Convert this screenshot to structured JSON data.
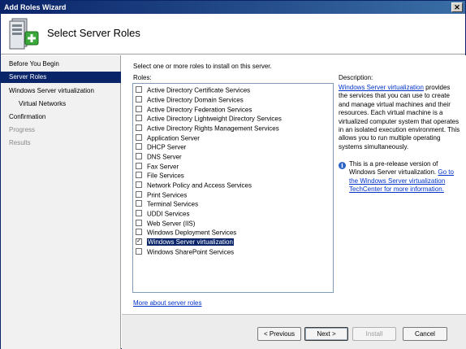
{
  "window": {
    "title": "Add Roles Wizard",
    "close_glyph": "✕"
  },
  "header": {
    "title": "Select Server Roles",
    "icon": "server-add-icon"
  },
  "nav": {
    "items": [
      {
        "label": "Before You Begin",
        "state": "normal"
      },
      {
        "label": "Server Roles",
        "state": "active"
      },
      {
        "label": "Windows Server virtualization",
        "state": "normal"
      },
      {
        "label": "Virtual Networks",
        "state": "sub"
      },
      {
        "label": "Confirmation",
        "state": "normal"
      },
      {
        "label": "Progress",
        "state": "disabled"
      },
      {
        "label": "Results",
        "state": "disabled"
      }
    ]
  },
  "main": {
    "instruction": "Select one or more roles to install on this server.",
    "roles_label": "Roles:",
    "roles": [
      {
        "label": "Active Directory Certificate Services",
        "checked": false
      },
      {
        "label": "Active Directory Domain Services",
        "checked": false
      },
      {
        "label": "Active Directory Federation Services",
        "checked": false
      },
      {
        "label": "Active Directory Lightweight Directory Services",
        "checked": false
      },
      {
        "label": "Active Directory Rights Management Services",
        "checked": false
      },
      {
        "label": "Application Server",
        "checked": false
      },
      {
        "label": "DHCP Server",
        "checked": false
      },
      {
        "label": "DNS Server",
        "checked": false
      },
      {
        "label": "Fax Server",
        "checked": false
      },
      {
        "label": "File Services",
        "checked": false
      },
      {
        "label": "Network Policy and Access Services",
        "checked": false
      },
      {
        "label": "Print Services",
        "checked": false
      },
      {
        "label": "Terminal Services",
        "checked": false
      },
      {
        "label": "UDDI Services",
        "checked": false
      },
      {
        "label": "Web Server (IIS)",
        "checked": false
      },
      {
        "label": "Windows Deployment Services",
        "checked": false
      },
      {
        "label": "Windows Server virtualization",
        "checked": true
      },
      {
        "label": "Windows SharePoint Services",
        "checked": false
      }
    ],
    "description_label": "Description:",
    "description_link": "Windows Server virtualization",
    "description_text": " provides the services that you can use to create and manage virtual machines and their resources. Each virtual machine is a virtualized computer system that operates in an isolated execution environment. This allows you to run multiple operating systems simultaneously.",
    "note_text": "This is a pre-release version of Windows Server virtualization. ",
    "note_link": "Go to the Windows Server virtualization TechCenter for more information.",
    "more_link": "More about server roles",
    "check_glyph": "✓",
    "info_glyph": "i"
  },
  "footer": {
    "previous": "< Previous",
    "next": "Next >",
    "install": "Install",
    "cancel": "Cancel"
  },
  "colors": {
    "selection": "#0a246a",
    "link": "#0033cc"
  }
}
